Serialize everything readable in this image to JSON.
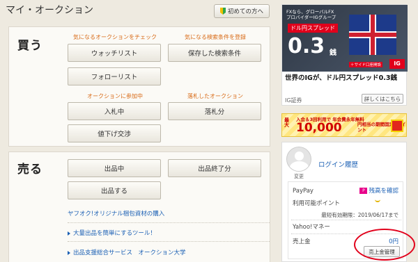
{
  "header": {
    "title": "マイ・オークション",
    "beginner_label": "初めての方へ"
  },
  "buy": {
    "title": "買う",
    "cap_watch": "気になるオークションをチェック",
    "cap_saved": "気になる検索条件を登録",
    "watchlist": "ウォッチリスト",
    "saved_search": "保存した検索条件",
    "follow": "フォローリスト",
    "cap_bidding": "オークションに参加中",
    "cap_won": "落札したオークション",
    "bidding": "入札中",
    "won": "落札分",
    "negotiation": "値下げ交渉"
  },
  "sell": {
    "title": "売る",
    "listing": "出品中",
    "ended": "出品終了分",
    "list_item": "出品する",
    "packing_link": "ヤフオク!オリジナル梱包資材の購入",
    "tool_link": "大量出品を簡単にするツール！",
    "support_link": "出品支援総合サービス　オークション大学"
  },
  "ad": {
    "top_line1": "FXなら、グローバルFX",
    "top_line2": "プロバイダーIGグループ",
    "label": "ドル円スプレッド",
    "big": "0.3",
    "unit": "銭",
    "logo": "IG",
    "mini": "＋サイド口座開設",
    "headline": "世界のIGが、ドル円スプレッド0.3銭",
    "source": "IG証券",
    "more": "詳しくはこちら"
  },
  "banner": {
    "side": "最大",
    "small": "入会＆3回利用で 年会費永年無料",
    "num": "10,000",
    "tail": "円相当の期間固定Tポイント"
  },
  "user": {
    "avatar_label": "変更",
    "login_history": "ログイン履歴",
    "paypay": "PayPay",
    "balance_check": "残高を確認",
    "available_points": "利用可能ポイント",
    "expire": "最短有効期限：2019/06/17まで",
    "yahoo_money": "Yahoo!マネー",
    "sales_label": "売上金",
    "sales_value": "0円",
    "sales_manage": "売上金管理"
  }
}
